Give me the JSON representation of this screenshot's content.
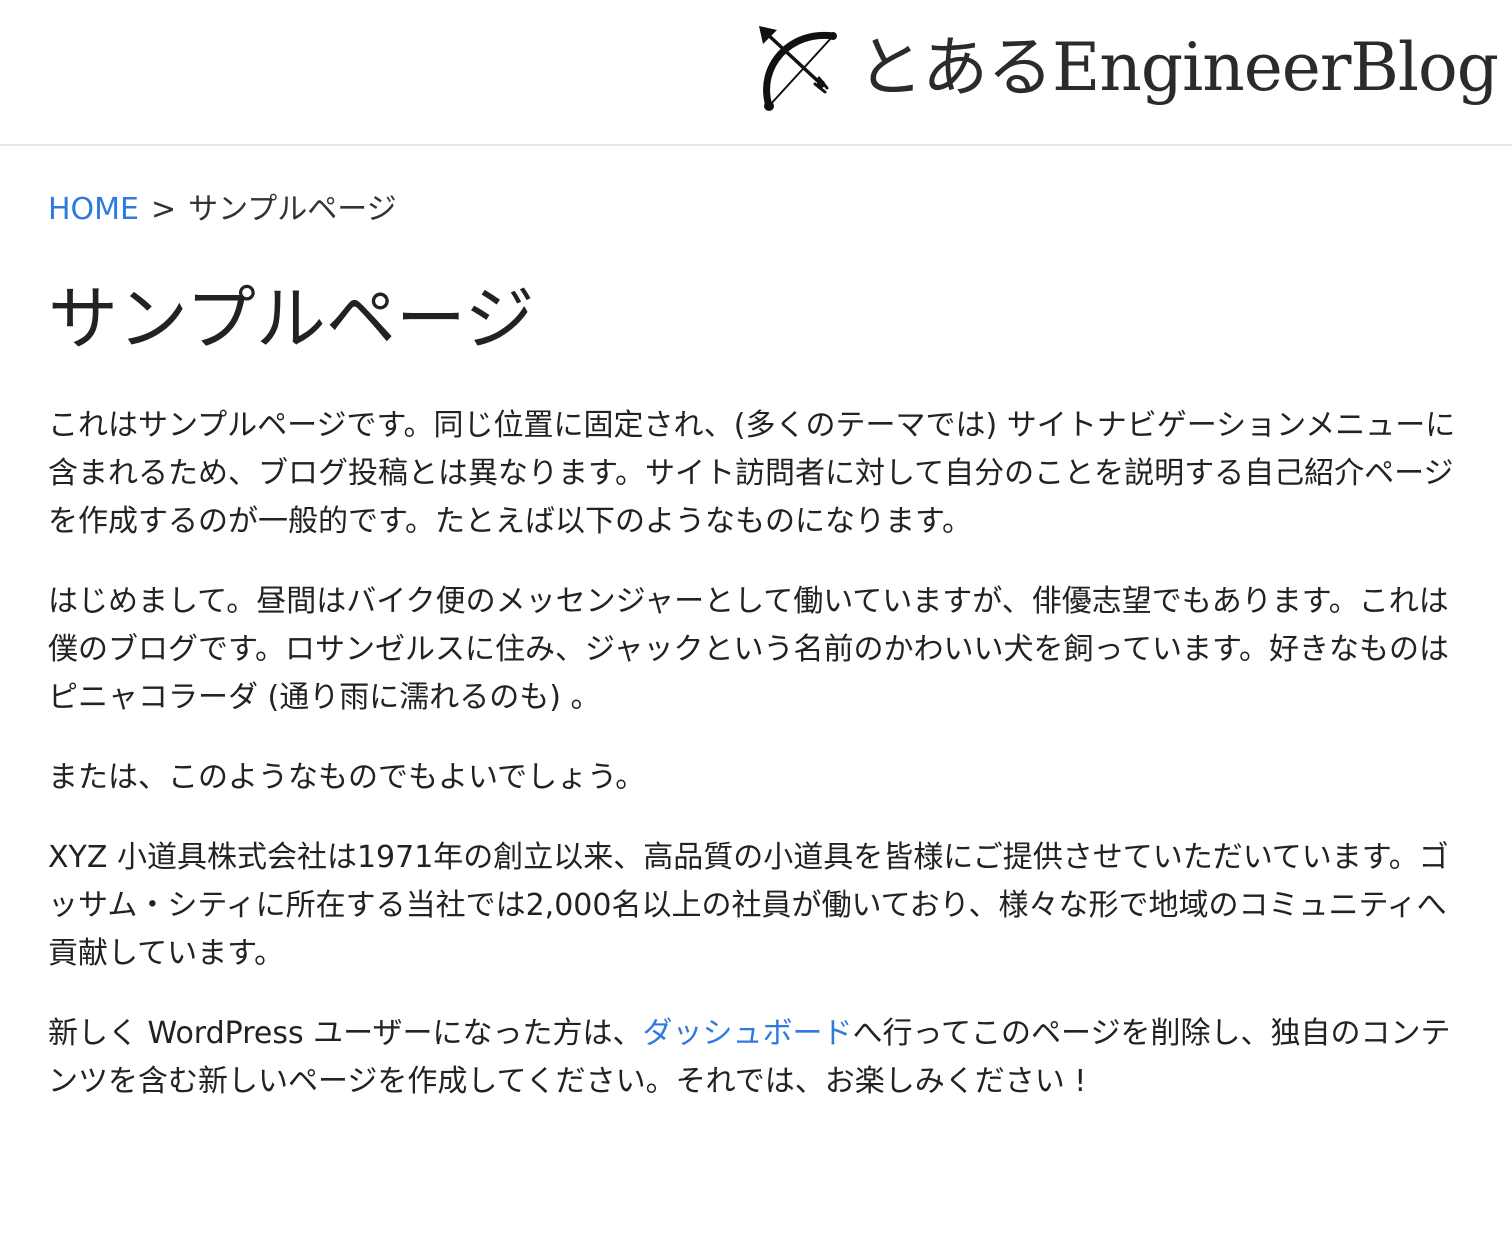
{
  "header": {
    "logo_icon": "bow-and-arrow-icon",
    "site_title": "とあるEngineerBlog"
  },
  "breadcrumb": {
    "home": "HOME",
    "separator": ">",
    "current": "サンプルページ"
  },
  "page": {
    "title": "サンプルページ",
    "paragraphs": [
      "これはサンプルページです。同じ位置に固定され、(多くのテーマでは) サイトナビゲーションメニューに含まれるため、ブログ投稿とは異なります。サイト訪問者に対して自分のことを説明する自己紹介ページを作成するのが一般的です。たとえば以下のようなものになります。",
      "はじめまして。昼間はバイク便のメッセンジャーとして働いていますが、俳優志望でもあります。これは僕のブログです。ロサンゼルスに住み、ジャックという名前のかわいい犬を飼っています。好きなものはピニャコラーダ (通り雨に濡れるのも) 。",
      "または、このようなものでもよいでしょう。",
      "XYZ 小道具株式会社は1971年の創立以来、高品質の小道具を皆様にご提供させていただいています。ゴッサム・シティに所在する当社では2,000名以上の社員が働いており、様々な形で地域のコミュニティへ貢献しています。"
    ],
    "last_paragraph": {
      "before": "新しく WordPress ユーザーになった方は、",
      "link": "ダッシュボード",
      "after": "へ行ってこのページを削除し、独自のコンテンツを含む新しいページを作成してください。それでは、お楽しみください !"
    }
  },
  "colors": {
    "link": "#2f7ae0",
    "text": "#222222",
    "divider": "#e6e6e6"
  }
}
